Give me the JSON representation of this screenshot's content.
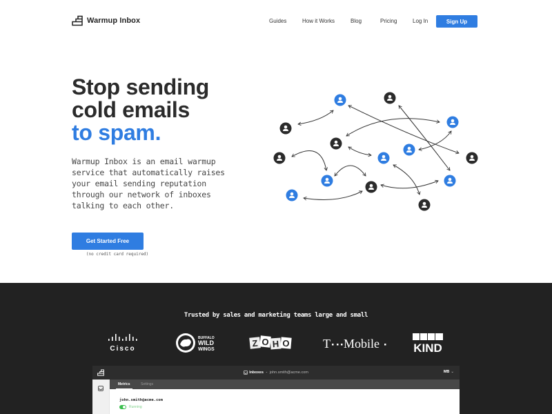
{
  "nav": {
    "brand_name": "Warmup  Inbox",
    "logo_icon": "stairs-logo-icon",
    "links": [
      "Guides",
      "How it Works",
      "Blog",
      "Pricing",
      "Log In"
    ],
    "signup_label": "Sign Up"
  },
  "hero": {
    "title_lines": [
      "Stop sending",
      "cold emails"
    ],
    "title_accent": "to spam.",
    "description": "Warmup Inbox is an email warmup service that automatically raises your email sending reputation through our network of inboxes talking to each other.",
    "cta_label": "Get Started Free",
    "cta_note": "(no credit card required)"
  },
  "network": {
    "accent_color": "#2f7de1",
    "dark_color": "#2b2b2b",
    "node_icon": "user-icon"
  },
  "trusted": {
    "heading": "Trusted by sales and marketing teams large and small",
    "logos": [
      "Cisco",
      "Buffalo Wild Wings",
      "ZOHO",
      "T-Mobile",
      "KIND"
    ]
  },
  "app": {
    "header_title": "Inboxes",
    "header_separator": " - ",
    "header_email": "john.smith@acme.com",
    "user_initials": "MB",
    "tabs": [
      "Metrics",
      "Settings"
    ],
    "inbox_email": "john.smith@acme.com",
    "status": "Running",
    "status_color": "#3cbf4f"
  },
  "colors": {
    "primary": "#2f7de1",
    "dark_bg": "#222222"
  }
}
